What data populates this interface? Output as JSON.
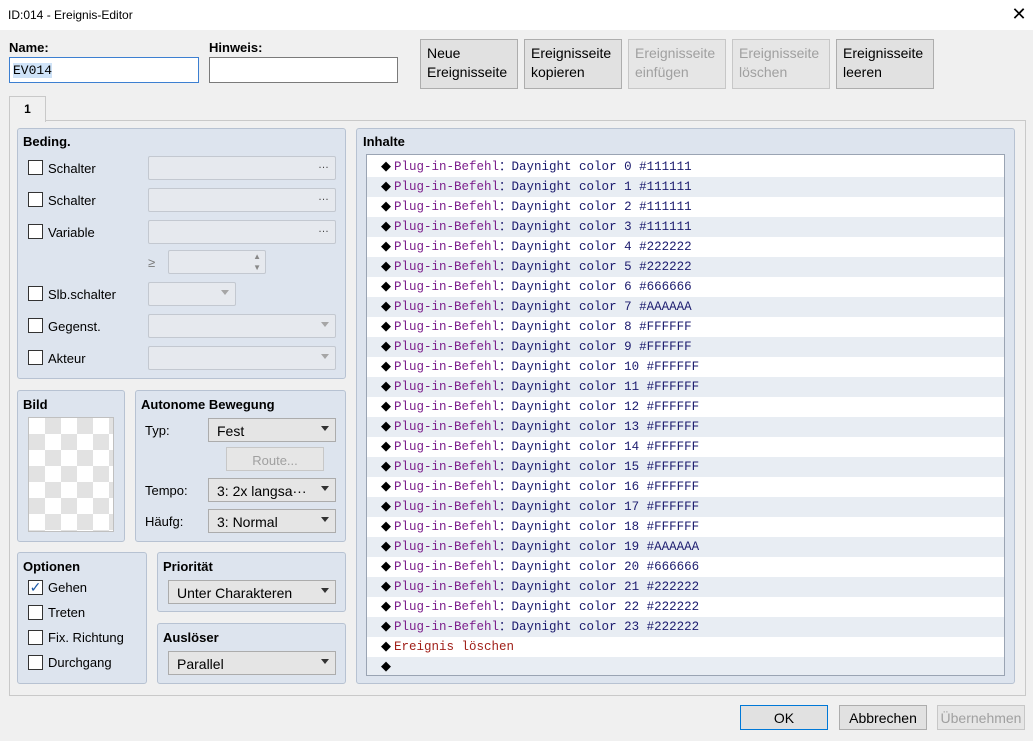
{
  "window": {
    "title": "ID:014 - Ereignis-Editor",
    "close_glyph": "✕"
  },
  "header": {
    "name_label": "Name:",
    "name_value": "EV014",
    "hint_label": "Hinweis:",
    "hint_value": ""
  },
  "toolbar": {
    "new_page": [
      "Neue",
      "Ereignisseite"
    ],
    "copy_page": [
      "Ereignisseite",
      "kopieren"
    ],
    "paste_page": [
      "Ereignisseite",
      "einfügen"
    ],
    "delete_page": [
      "Ereignisseite",
      "löschen"
    ],
    "clear_page": [
      "Ereignisseite",
      "leeren"
    ]
  },
  "tabs": [
    {
      "label": "1"
    }
  ],
  "conditions": {
    "title": "Beding.",
    "switch1_label": "Schalter",
    "switch2_label": "Schalter",
    "variable_label": "Variable",
    "gte_symbol": "≥",
    "self_switch_label": "Slb.schalter",
    "item_label": "Gegenst.",
    "actor_label": "Akteur",
    "ellipsis": "…"
  },
  "image": {
    "title": "Bild"
  },
  "autonomous": {
    "title": "Autonome Bewegung",
    "type_label": "Typ:",
    "type_value": "Fest",
    "route_button": "Route...",
    "speed_label": "Tempo:",
    "speed_value": "3: 2x langsa···",
    "freq_label": "Häufg:",
    "freq_value": "3: Normal"
  },
  "options": {
    "title": "Optionen",
    "walking": {
      "label": "Gehen",
      "checked": true,
      "check_glyph": "✓"
    },
    "stepping": {
      "label": "Treten",
      "checked": false
    },
    "direction_fix": {
      "label": "Fix. Richtung",
      "checked": false
    },
    "through": {
      "label": "Durchgang",
      "checked": false
    }
  },
  "priority": {
    "title": "Priorität",
    "value": "Unter Charakteren"
  },
  "trigger": {
    "title": "Auslöser",
    "value": "Parallel"
  },
  "contents": {
    "title": "Inhalte",
    "bullet": "◆",
    "command_name": "Plug-in-Befehl",
    "separator": "：",
    "rows": [
      "Daynight color 0 #111111",
      "Daynight color 1 #111111",
      "Daynight color 2 #111111",
      "Daynight color 3 #111111",
      "Daynight color 4 #222222",
      "Daynight color 5 #222222",
      "Daynight color 6 #666666",
      "Daynight color 7 #AAAAAA",
      "Daynight color 8 #FFFFFF",
      "Daynight color 9 #FFFFFF",
      "Daynight color 10 #FFFFFF",
      "Daynight color 11 #FFFFFF",
      "Daynight color 12 #FFFFFF",
      "Daynight color 13 #FFFFFF",
      "Daynight color 14 #FFFFFF",
      "Daynight color 15 #FFFFFF",
      "Daynight color 16 #FFFFFF",
      "Daynight color 17 #FFFFFF",
      "Daynight color 18 #FFFFFF",
      "Daynight color 19 #AAAAAA",
      "Daynight color 20 #666666",
      "Daynight color 21 #222222",
      "Daynight color 22 #222222",
      "Daynight color 23 #222222"
    ],
    "erase_event": "Ereignis löschen"
  },
  "footer": {
    "ok": "OK",
    "cancel": "Abbrechen",
    "apply": "Übernehmen"
  },
  "colors": {
    "panel": "#dde4ee",
    "command_purple": "#7c1f8c",
    "text_navy": "#1b1b6e",
    "erase_maroon": "#a0201a"
  }
}
